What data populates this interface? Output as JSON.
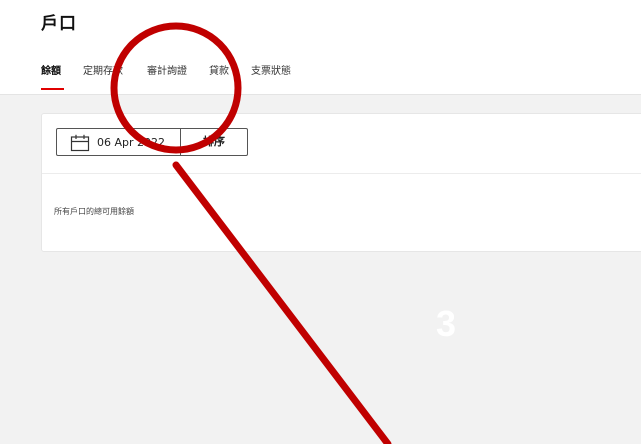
{
  "page": {
    "title": "戶口"
  },
  "tabs": [
    {
      "label": "餘額",
      "active": true
    },
    {
      "label": "定期存款",
      "active": false
    },
    {
      "label": "審計詢證",
      "active": false
    },
    {
      "label": "貸款",
      "active": false
    },
    {
      "label": "支票狀態",
      "active": false
    }
  ],
  "toolbar": {
    "date_value": "06 Apr 2022",
    "date_icon": "calendar-icon",
    "sort_label": "排序"
  },
  "card": {
    "caption": "所有戶口的總可用餘額"
  },
  "annotation": {
    "step_number": "3",
    "highlight_color": "#c00000"
  },
  "colors": {
    "accent": "#e00000",
    "background": "#f2f2f2"
  }
}
